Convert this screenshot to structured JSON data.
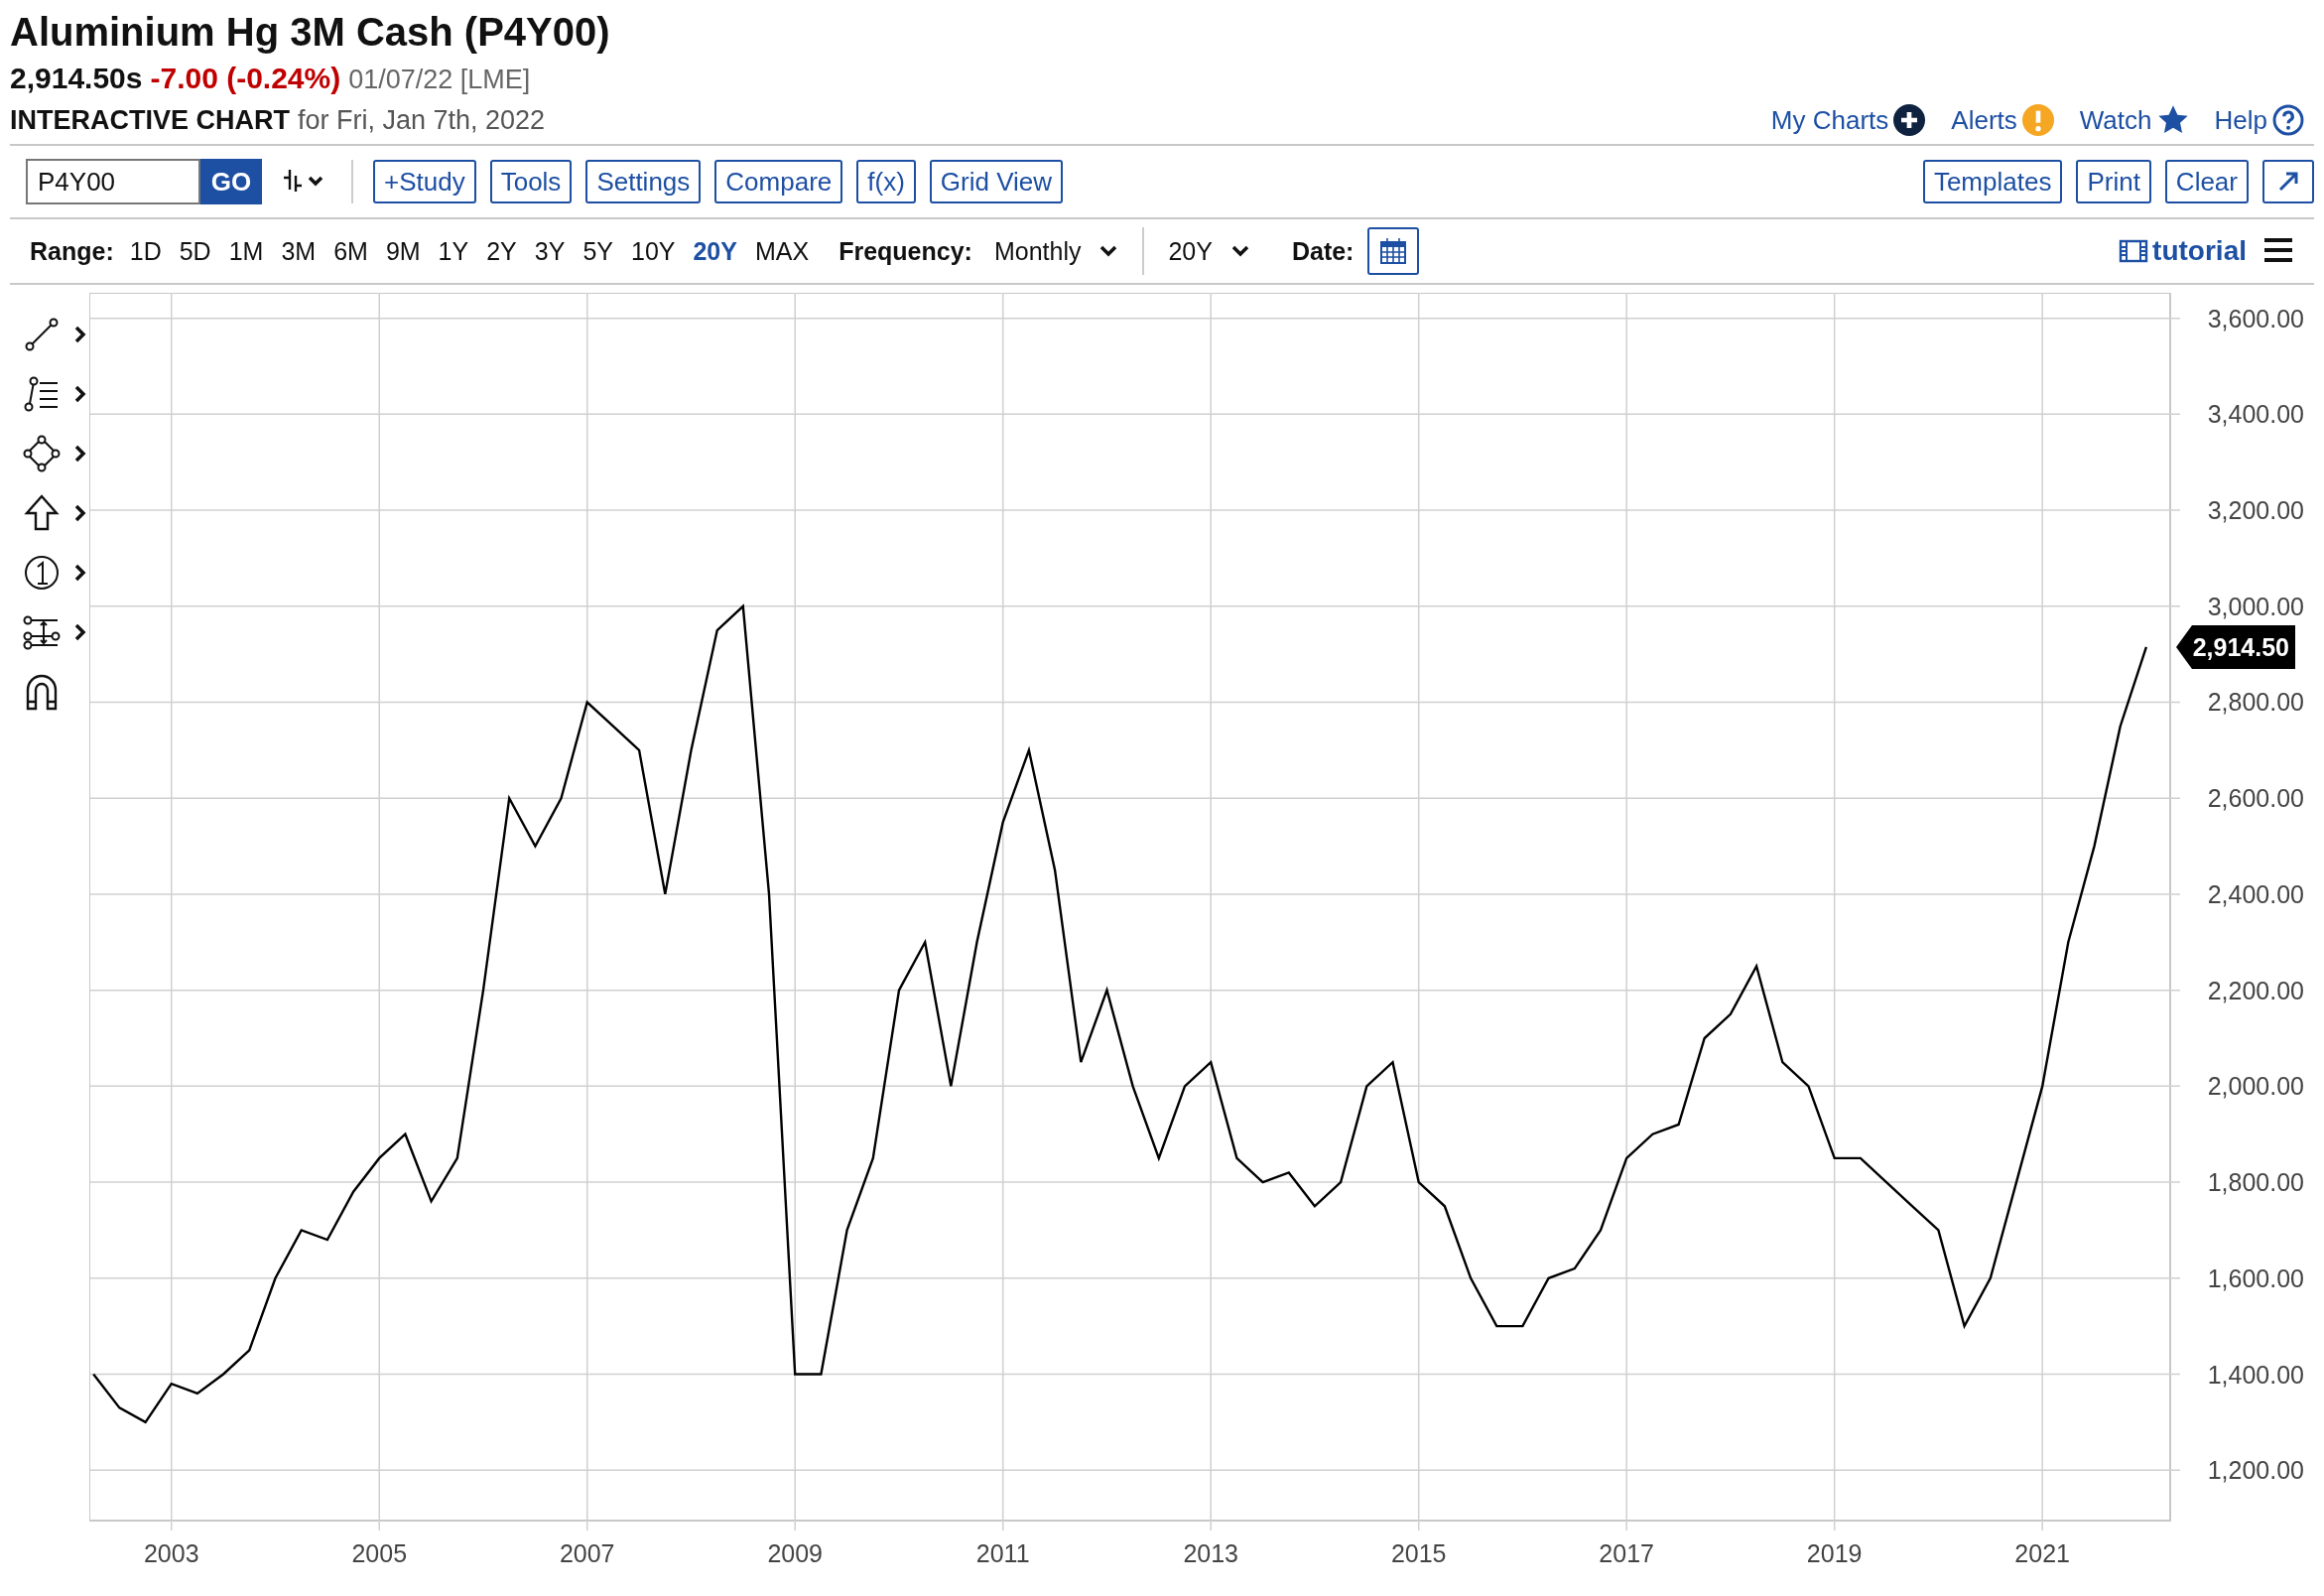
{
  "header": {
    "title": "Aluminium Hg 3M Cash (P4Y00)",
    "price": "2,914.50s",
    "change": "-7.00 (-0.24%)",
    "date_exchange": "01/07/22 [LME]",
    "chart_label": "INTERACTIVE CHART",
    "chart_date": "for Fri, Jan 7th, 2022"
  },
  "top_links": [
    {
      "label": "My Charts",
      "kind": "plus"
    },
    {
      "label": "Alerts",
      "kind": "alert"
    },
    {
      "label": "Watch",
      "kind": "star"
    },
    {
      "label": "Help",
      "kind": "help"
    }
  ],
  "toolbar": {
    "symbol": "P4Y00",
    "go": "GO",
    "buttons": [
      "+Study",
      "Tools",
      "Settings",
      "Compare",
      "f(x)",
      "Grid View"
    ],
    "right_buttons": [
      "Templates",
      "Print",
      "Clear"
    ]
  },
  "range": {
    "label": "Range:",
    "items": [
      {
        "label": "1D",
        "selected": false
      },
      {
        "label": "5D",
        "selected": false
      },
      {
        "label": "1M",
        "selected": false
      },
      {
        "label": "3M",
        "selected": false
      },
      {
        "label": "6M",
        "selected": false
      },
      {
        "label": "9M",
        "selected": false
      },
      {
        "label": "1Y",
        "selected": false
      },
      {
        "label": "2Y",
        "selected": false
      },
      {
        "label": "3Y",
        "selected": false
      },
      {
        "label": "5Y",
        "selected": false
      },
      {
        "label": "10Y",
        "selected": false
      },
      {
        "label": "20Y",
        "selected": true
      },
      {
        "label": "MAX",
        "selected": false
      }
    ],
    "frequency_label": "Frequency:",
    "frequency": "Monthly",
    "period": "20Y",
    "date_label": "Date:",
    "tutorial": "tutorial"
  },
  "drawing_tools": [
    {
      "kind": "line",
      "submenu": true
    },
    {
      "kind": "fib",
      "submenu": true
    },
    {
      "kind": "shape",
      "submenu": true
    },
    {
      "kind": "arrow",
      "submenu": true
    },
    {
      "kind": "number",
      "submenu": true
    },
    {
      "kind": "measure",
      "submenu": true
    },
    {
      "kind": "magnet",
      "submenu": false
    }
  ],
  "chart": {
    "price_tag": "2,914.50",
    "chart_data": {
      "type": "line",
      "x": [
        2002.25,
        2002.5,
        2002.75,
        2003.0,
        2003.25,
        2003.5,
        2003.75,
        2004.0,
        2004.25,
        2004.5,
        2004.75,
        2005.0,
        2005.25,
        2005.5,
        2005.75,
        2006.0,
        2006.25,
        2006.5,
        2006.75,
        2007.0,
        2007.25,
        2007.5,
        2007.75,
        2008.0,
        2008.25,
        2008.5,
        2008.75,
        2009.0,
        2009.25,
        2009.5,
        2009.75,
        2010.0,
        2010.25,
        2010.5,
        2010.75,
        2011.0,
        2011.25,
        2011.5,
        2011.75,
        2012.0,
        2012.25,
        2012.5,
        2012.75,
        2013.0,
        2013.25,
        2013.5,
        2013.75,
        2014.0,
        2014.25,
        2014.5,
        2014.75,
        2015.0,
        2015.25,
        2015.5,
        2015.75,
        2016.0,
        2016.25,
        2016.5,
        2016.75,
        2017.0,
        2017.25,
        2017.5,
        2017.75,
        2018.0,
        2018.25,
        2018.5,
        2018.75,
        2019.0,
        2019.25,
        2019.5,
        2019.75,
        2020.0,
        2020.25,
        2020.5,
        2020.75,
        2021.0,
        2021.25,
        2021.5,
        2021.75,
        2022.0
      ],
      "grid": true,
      "series": [
        {
          "color": "#000000",
          "values": [
            1400,
            1330,
            1300,
            1380,
            1360,
            1400,
            1450,
            1600,
            1700,
            1680,
            1780,
            1850,
            1900,
            1760,
            1850,
            2200,
            2600,
            2500,
            2600,
            2800,
            2750,
            2700,
            2400,
            2700,
            2950,
            3000,
            2400,
            1400,
            1400,
            1700,
            1850,
            2200,
            2300,
            2000,
            2300,
            2550,
            2700,
            2450,
            2050,
            2200,
            2000,
            1850,
            2000,
            2050,
            1850,
            1800,
            1820,
            1750,
            1800,
            2000,
            2050,
            1800,
            1750,
            1600,
            1500,
            1500,
            1600,
            1620,
            1700,
            1850,
            1900,
            1920,
            2100,
            2150,
            2250,
            2050,
            2000,
            1850,
            1850,
            1800,
            1750,
            1700,
            1500,
            1600,
            1800,
            2000,
            2300,
            2500,
            2750,
            2915
          ]
        }
      ],
      "xlim": [
        2002.21,
        2022.23
      ],
      "ylim": [
        1095,
        3653
      ],
      "xticks": [
        2003,
        2005,
        2007,
        2009,
        2011,
        2013,
        2015,
        2017,
        2019,
        2021
      ],
      "yticks": [
        {
          "value": 1200,
          "label": "1,200.00"
        },
        {
          "value": 1400,
          "label": "1,400.00"
        },
        {
          "value": 1600,
          "label": "1,600.00"
        },
        {
          "value": 1800,
          "label": "1,800.00"
        },
        {
          "value": 2000,
          "label": "2,000.00"
        },
        {
          "value": 2200,
          "label": "2,200.00"
        },
        {
          "value": 2400,
          "label": "2,400.00"
        },
        {
          "value": 2600,
          "label": "2,600.00"
        },
        {
          "value": 2800,
          "label": "2,800.00"
        },
        {
          "value": 3000,
          "label": "3,000.00"
        },
        {
          "value": 3200,
          "label": "3,200.00"
        },
        {
          "value": 3400,
          "label": "3,400.00"
        },
        {
          "value": 3600,
          "label": "3,600.00"
        }
      ]
    }
  }
}
